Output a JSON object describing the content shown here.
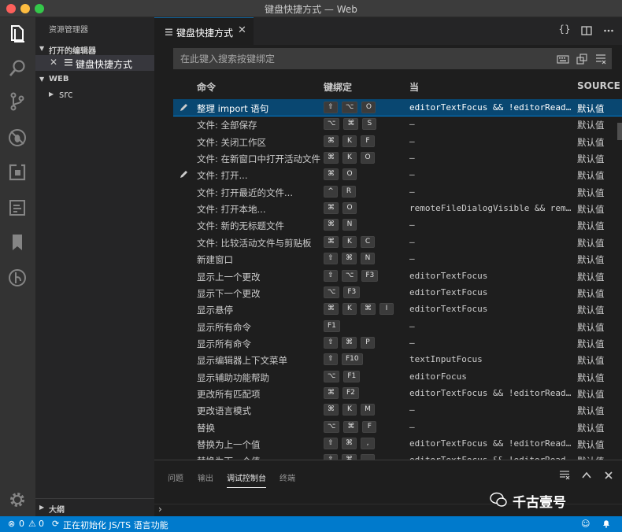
{
  "window": {
    "title": "键盘快捷方式 — Web"
  },
  "activity_bar": {
    "icons": [
      "files-icon",
      "search-icon",
      "source-control-icon",
      "debug-icon",
      "extensions-icon",
      "output-icon",
      "bookmark-icon",
      "gitlens-icon",
      "gear-icon"
    ]
  },
  "sidebar": {
    "title": "资源管理器",
    "open_editors_label": "打开的编辑器",
    "open_editor_name": "键盘快捷方式",
    "workspace_label": "WEB",
    "tree_item": "src",
    "outline_label": "大纲"
  },
  "editor": {
    "tab_label": "键盘快捷方式",
    "actions": [
      "{}",
      "split-editor-icon",
      "more-icon"
    ],
    "search_placeholder": "在此键入搜索按键绑定",
    "columns": {
      "command": "命令",
      "keybinding": "键绑定",
      "when": "当",
      "source": "SOURCE"
    },
    "rows": [
      {
        "command": "整理 import 语句",
        "keys": [
          "⇧",
          "⌥",
          "O"
        ],
        "when": "editorTextFocus && !editorReadonly",
        "source": "默认值",
        "edited": true,
        "selected": true
      },
      {
        "command": "文件: 全部保存",
        "keys": [
          "⌥",
          "⌘",
          "S"
        ],
        "when": "—",
        "source": "默认值"
      },
      {
        "command": "文件: 关闭工作区",
        "keys": [
          "⌘",
          "K",
          "F"
        ],
        "when": "—",
        "source": "默认值"
      },
      {
        "command": "文件: 在新窗口中打开活动文件",
        "keys": [
          "⌘",
          "K",
          "O"
        ],
        "when": "—",
        "source": "默认值"
      },
      {
        "command": "文件: 打开...",
        "keys": [
          "⌘",
          "O"
        ],
        "when": "—",
        "source": "默认值",
        "edited": true
      },
      {
        "command": "文件: 打开最近的文件...",
        "keys": [
          "^",
          "R"
        ],
        "when": "—",
        "source": "默认值"
      },
      {
        "command": "文件: 打开本地...",
        "keys": [
          "⌘",
          "O"
        ],
        "when": "remoteFileDialogVisible && remoteFileDialog",
        "source": "默认值"
      },
      {
        "command": "文件: 新的无标题文件",
        "keys": [
          "⌘",
          "N"
        ],
        "when": "—",
        "source": "默认值"
      },
      {
        "command": "文件: 比较活动文件与剪贴板",
        "keys": [
          "⌘",
          "K",
          "C"
        ],
        "when": "—",
        "source": "默认值"
      },
      {
        "command": "新建窗口",
        "keys": [
          "⇧",
          "⌘",
          "N"
        ],
        "when": "—",
        "source": "默认值"
      },
      {
        "command": "显示上一个更改",
        "keys": [
          "⇧",
          "⌥",
          "F3"
        ],
        "when": "editorTextFocus",
        "source": "默认值"
      },
      {
        "command": "显示下一个更改",
        "keys": [
          "⌥",
          "F3"
        ],
        "when": "editorTextFocus",
        "source": "默认值"
      },
      {
        "command": "显示悬停",
        "keys": [
          "⌘",
          "K",
          "⌘",
          "I"
        ],
        "when": "editorTextFocus",
        "source": "默认值"
      },
      {
        "command": "显示所有命令",
        "keys": [
          "F1"
        ],
        "when": "—",
        "source": "默认值"
      },
      {
        "command": "显示所有命令",
        "keys": [
          "⇧",
          "⌘",
          "P"
        ],
        "when": "—",
        "source": "默认值"
      },
      {
        "command": "显示编辑器上下文菜单",
        "keys": [
          "⇧",
          "F10"
        ],
        "when": "textInputFocus",
        "source": "默认值"
      },
      {
        "command": "显示辅助功能帮助",
        "keys": [
          "⌥",
          "F1"
        ],
        "when": "editorFocus",
        "source": "默认值"
      },
      {
        "command": "更改所有匹配项",
        "keys": [
          "⌘",
          "F2"
        ],
        "when": "editorTextFocus && !editorReadonly",
        "source": "默认值"
      },
      {
        "command": "更改语言模式",
        "keys": [
          "⌘",
          "K",
          "M"
        ],
        "when": "—",
        "source": "默认值"
      },
      {
        "command": "替换",
        "keys": [
          "⌥",
          "⌘",
          "F"
        ],
        "when": "—",
        "source": "默认值"
      },
      {
        "command": "替换为上一个值",
        "keys": [
          "⇧",
          "⌘",
          ","
        ],
        "when": "editorTextFocus && !editorReadonly",
        "source": "默认值"
      },
      {
        "command": "替换为下一个值",
        "keys": [
          "⇧",
          "⌘",
          "."
        ],
        "when": "editorTextFocus && !editorReadonly",
        "source": "默认值"
      }
    ]
  },
  "panel": {
    "tabs": [
      "问题",
      "输出",
      "调试控制台",
      "终端"
    ],
    "active_tab": "调试控制台",
    "prompt": "›",
    "watermark": "千古壹号"
  },
  "status_bar": {
    "errors": "0",
    "warnings": "0",
    "message": "正在初始化 JS/TS 语言功能"
  },
  "colors": {
    "accent": "#007acc",
    "selection": "#094771",
    "traffic_red": "#fc605b",
    "traffic_yellow": "#fdbc40",
    "traffic_green": "#34c84a"
  }
}
